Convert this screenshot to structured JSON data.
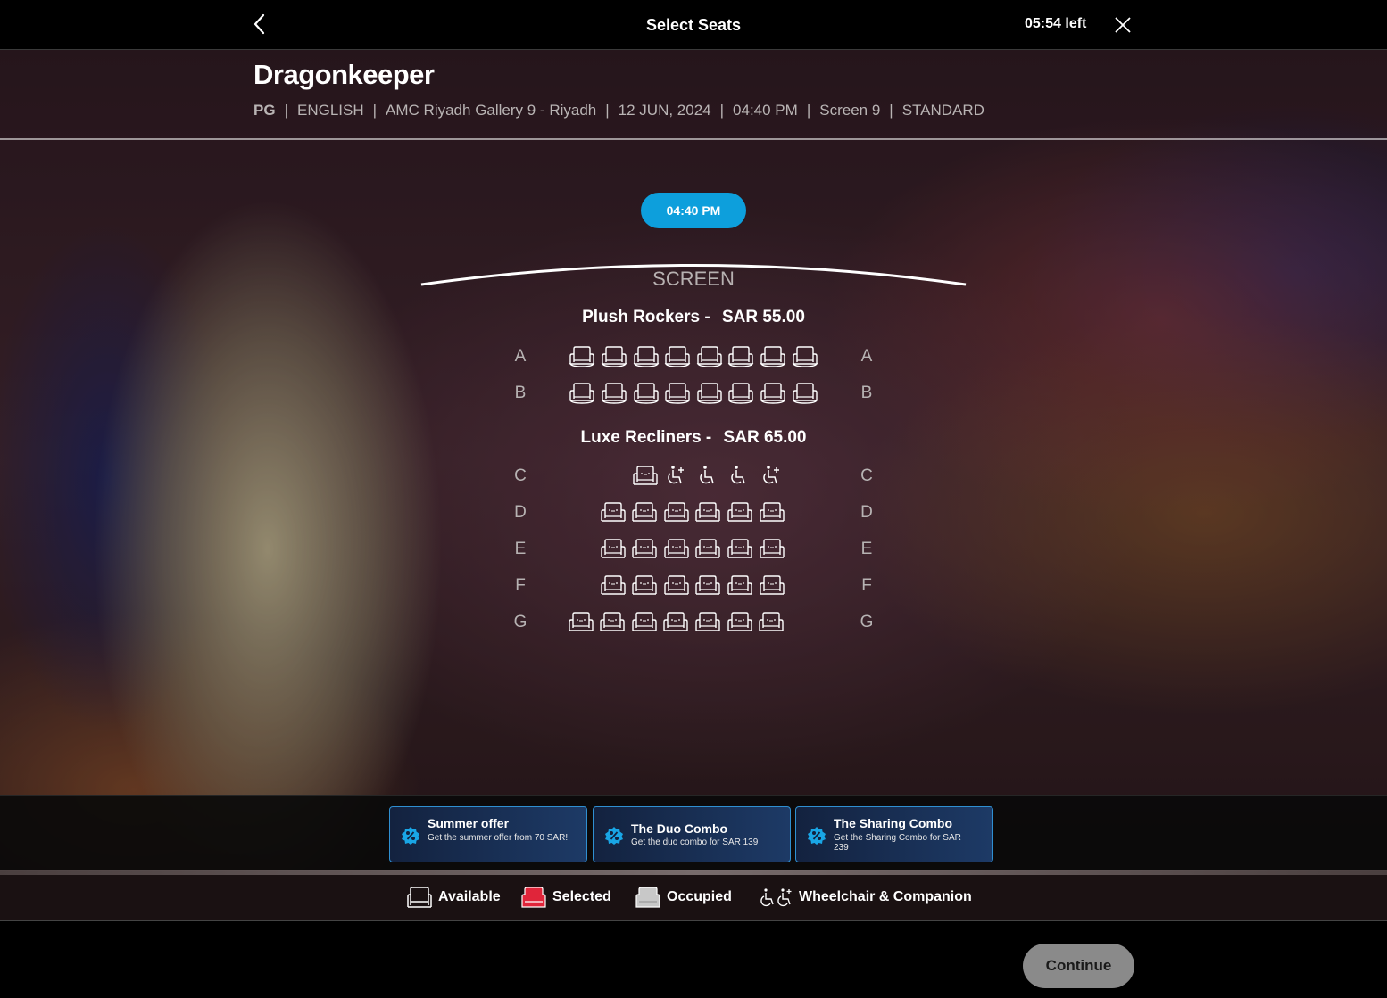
{
  "header": {
    "title": "Select Seats",
    "timer": "05:54 left"
  },
  "movie": {
    "title": "Dragonkeeper",
    "meta": [
      "PG",
      "ENGLISH",
      "AMC Riyadh Gallery 9 - Riyadh",
      "12 JUN, 2024",
      "04:40 PM",
      "Screen 9",
      "STANDARD"
    ],
    "meta_separator": "|"
  },
  "showtime": "04:40 PM",
  "screen_label": "SCREEN",
  "sections": [
    {
      "name": "Plush Rockers -",
      "price": "SAR  55.00"
    },
    {
      "name": "Luxe Recliners -",
      "price": "SAR  65.00"
    }
  ],
  "rows": [
    {
      "label": "A",
      "seat_type": "rocker",
      "seats": [
        "available",
        "available",
        "available",
        "available",
        "available",
        "available",
        "available",
        "available"
      ]
    },
    {
      "label": "B",
      "seat_type": "rocker",
      "seats": [
        "available",
        "available",
        "available",
        "available",
        "available",
        "available",
        "available",
        "available"
      ]
    },
    {
      "label": "C",
      "seat_type": "recliner",
      "seats": [
        "available",
        "wheelchair-companion",
        "wheelchair",
        "wheelchair",
        "wheelchair-companion"
      ]
    },
    {
      "label": "D",
      "seat_type": "recliner",
      "seats": [
        "available",
        "available",
        "available",
        "available",
        "available",
        "available"
      ]
    },
    {
      "label": "E",
      "seat_type": "recliner",
      "seats": [
        "available",
        "available",
        "available",
        "available",
        "available",
        "available"
      ]
    },
    {
      "label": "F",
      "seat_type": "recliner",
      "seats": [
        "available",
        "available",
        "available",
        "available",
        "available",
        "available"
      ]
    },
    {
      "label": "G",
      "seat_type": "recliner",
      "seats": [
        "available",
        "available",
        "available",
        "available",
        "available",
        "available",
        "available"
      ]
    }
  ],
  "offers": [
    {
      "title": "Summer offer",
      "description": "Get the summer offer from 70 SAR!",
      "icon": "discount-icon"
    },
    {
      "title": "The Duo Combo",
      "description": "Get the duo combo for SAR 139",
      "icon": "discount-icon"
    },
    {
      "title": "The Sharing Combo",
      "description": "Get the Sharing Combo for SAR 239",
      "icon": "discount-icon"
    }
  ],
  "legend": {
    "available": "Available",
    "selected": "Selected",
    "occupied": "Occupied",
    "wheelchair": "Wheelchair & Companion"
  },
  "continue_label": "Continue",
  "colors": {
    "accent": "#0d9fdc",
    "selected": "#e0253a",
    "occupied": "#c8c8c8",
    "offer_border": "#2f8fd1"
  }
}
